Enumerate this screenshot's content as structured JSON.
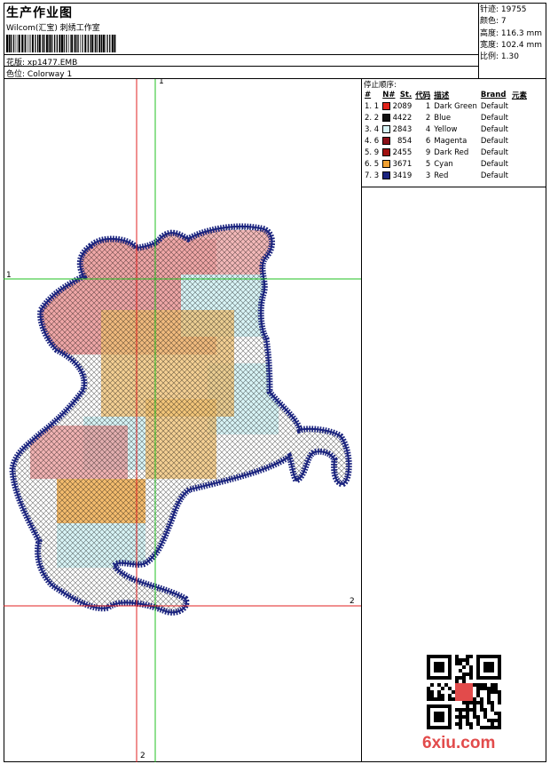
{
  "header": {
    "title": "生产作业图",
    "subtitle": "Wilcom(汇宝) 刺绣工作室",
    "design_label": "花版:",
    "design_value": "xp1477.EMB",
    "colorway_label": "色位:",
    "colorway_value": "Colorway 1"
  },
  "stats": {
    "stitches": "针迹: 19755",
    "colors": "颜色: 7",
    "height": "高度: 116.3 mm",
    "width": "宽度: 102.4 mm",
    "scale": "比例: 1.30"
  },
  "sequence": {
    "title": "停止顺序:",
    "headers": [
      "#",
      "N#",
      "St.",
      "代码",
      "描述",
      "Brand",
      "元素"
    ],
    "rows": [
      {
        "idx": "1. 1",
        "color": "#e0231b",
        "st": "2089",
        "code": "1",
        "desc": "Dark Green",
        "brand": "Default"
      },
      {
        "idx": "2. 2",
        "color": "#111111",
        "st": "4422",
        "code": "2",
        "desc": "Blue",
        "brand": "Default"
      },
      {
        "idx": "3. 4",
        "color": "#d8f4f6",
        "st": "2843",
        "code": "4",
        "desc": "Yellow",
        "brand": "Default"
      },
      {
        "idx": "4. 6",
        "color": "#8a1018",
        "st": "854",
        "code": "6",
        "desc": "Magenta",
        "brand": "Default"
      },
      {
        "idx": "5. 9",
        "color": "#a01010",
        "st": "2455",
        "code": "9",
        "desc": "Dark Red",
        "brand": "Default"
      },
      {
        "idx": "6. 5",
        "color": "#f0a030",
        "st": "3671",
        "code": "5",
        "desc": "Cyan",
        "brand": "Default"
      },
      {
        "idx": "7. 3",
        "color": "#1a237e",
        "st": "3419",
        "code": "3",
        "desc": "Red",
        "brand": "Default"
      }
    ]
  },
  "guides": {
    "v1": "1",
    "h1": "1",
    "h2": "2",
    "v2": "2"
  },
  "watermark": "6xiu.com",
  "colors": {
    "outline": "#1a237e",
    "guide_red": "#e02020",
    "guide_green": "#20c020"
  }
}
